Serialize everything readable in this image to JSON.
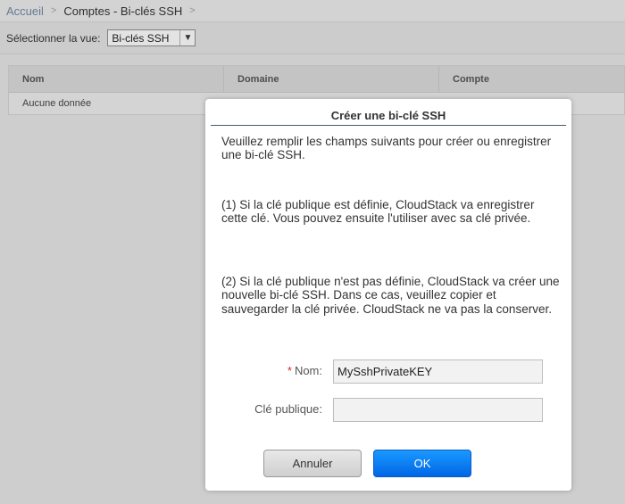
{
  "breadcrumb": {
    "home": "Accueil",
    "separator": ">",
    "current": "Comptes - Bi-clés SSH",
    "trailing_separator": ">"
  },
  "view_bar": {
    "label": "Sélectionner la vue:",
    "selected": "Bi-clés SSH"
  },
  "grid": {
    "columns": [
      "Nom",
      "Domaine",
      "Compte"
    ],
    "empty_text": "Aucune donnée"
  },
  "dialog": {
    "title": "Créer une bi-clé SSH",
    "paragraphs": [
      "Veuillez remplir les champs suivants pour créer ou enregistrer une bi-clé SSH.",
      "(1) Si la clé publique est définie, CloudStack va enregistrer cette clé. Vous pouvez ensuite l'utiliser avec sa clé privée.",
      "(2) Si la clé publique n'est pas définie, CloudStack va créer une nouvelle bi-clé SSH. Dans ce cas, veuillez copier et sauvegarder la clé privée. CloudStack ne va pas la conserver."
    ],
    "fields": {
      "name": {
        "required_mark": "*",
        "label": "Nom:",
        "value": "MySshPrivateKEY"
      },
      "public_key": {
        "label": "Clé publique:",
        "value": ""
      }
    },
    "buttons": {
      "cancel": "Annuler",
      "ok": "OK"
    }
  },
  "colors": {
    "ok_button": "#0a7ff0",
    "required": "#cc2a2a",
    "link": "#6f86a4"
  }
}
